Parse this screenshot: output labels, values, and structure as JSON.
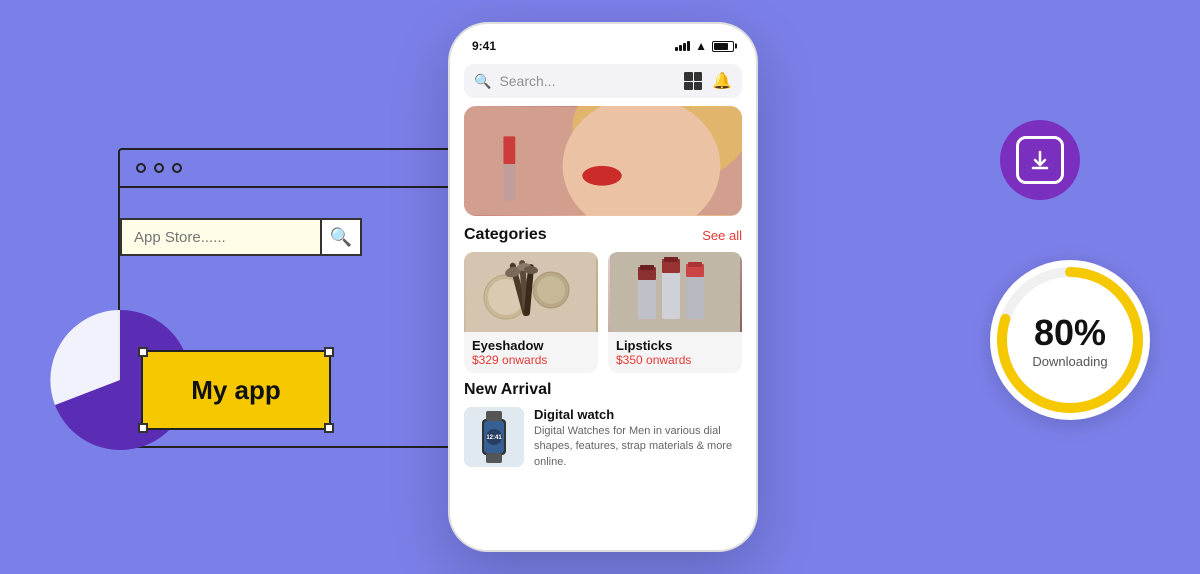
{
  "background_color": "#7B7FE8",
  "left": {
    "appstore_placeholder": "App Store......",
    "my_app_label": "My app"
  },
  "phone": {
    "status": {
      "time": "9:41"
    },
    "search_placeholder": "Search...",
    "hero_image_alt": "Woman with lipstick",
    "categories_title": "Categories",
    "see_all": "See all",
    "categories": [
      {
        "name": "Eyeshadow",
        "price": "$329 onwards"
      },
      {
        "name": "Lipsticks",
        "price": "$350 onwards"
      }
    ],
    "new_arrival_title": "New Arrival",
    "new_arrival_items": [
      {
        "name": "Digital watch",
        "desc": "Digital Watches for Men in various dial shapes, features, strap materials & more online."
      }
    ]
  },
  "right": {
    "download_icon": "↓",
    "progress_percent": "80%",
    "progress_label": "Downloading",
    "progress_value": 80
  }
}
